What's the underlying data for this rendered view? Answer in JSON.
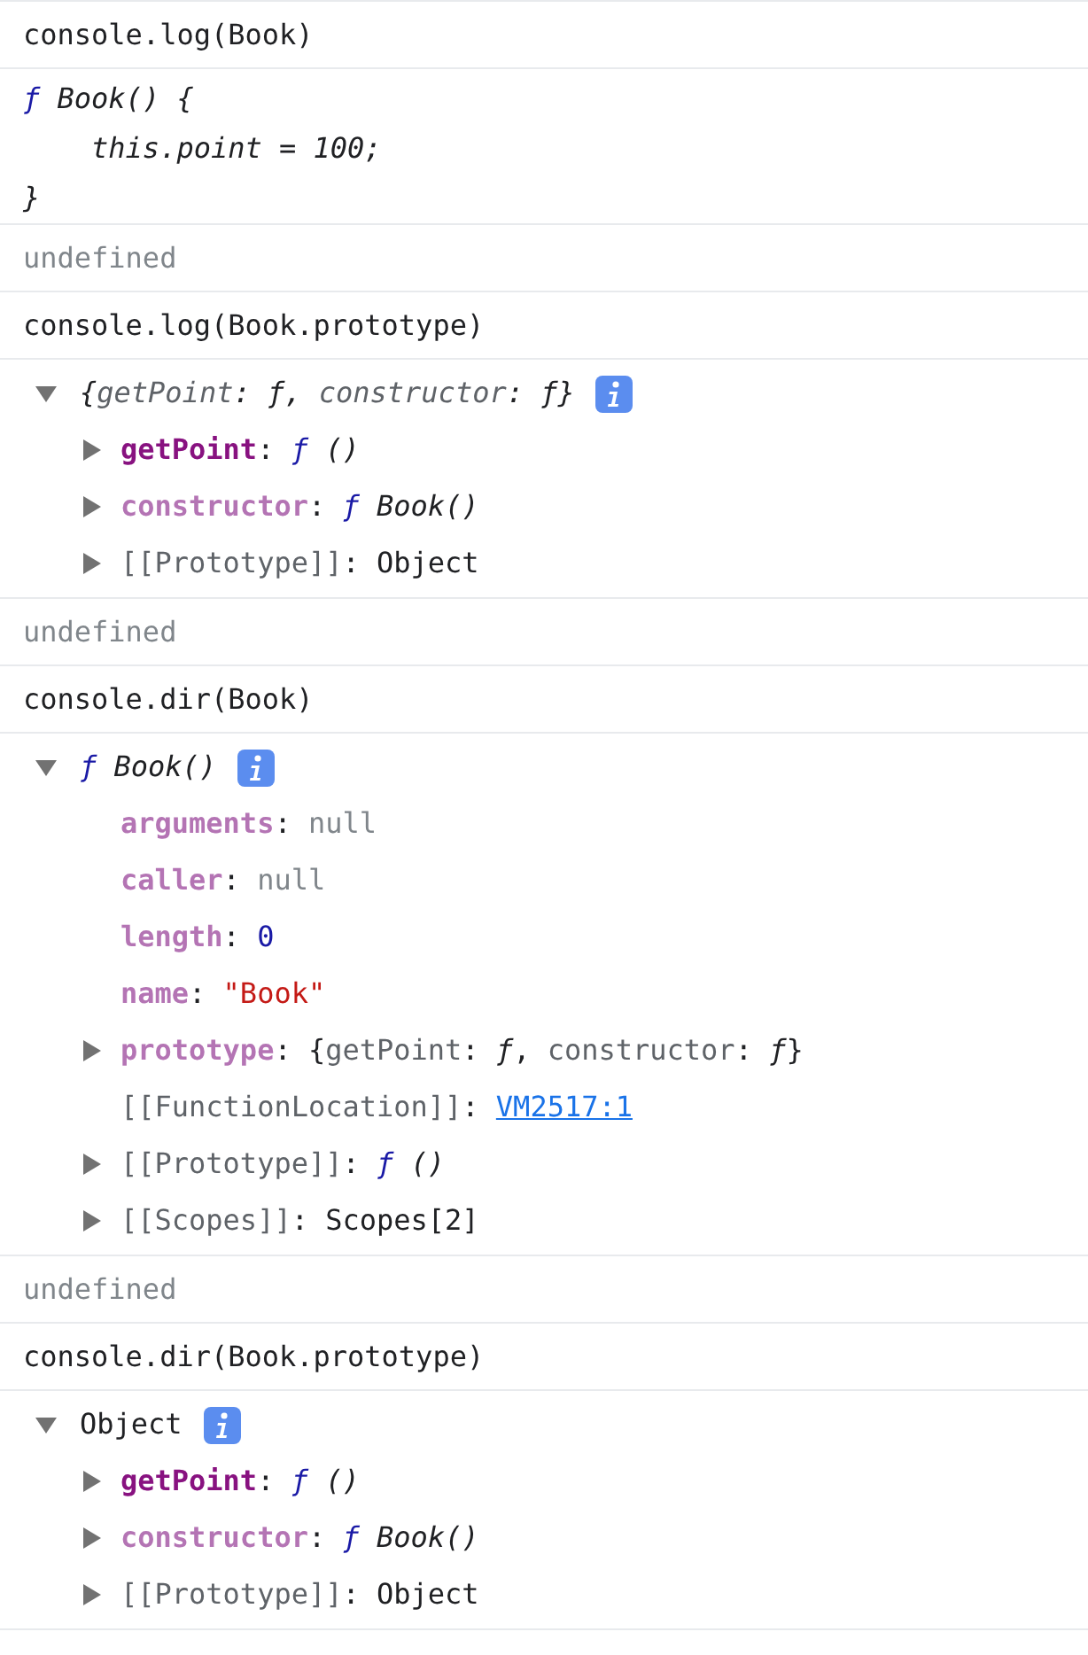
{
  "entries": [
    {
      "kind": "command",
      "text": "console.log(Book)"
    },
    {
      "kind": "source",
      "lines": [
        [
          {
            "kind": "fn",
            "text": "ƒ"
          },
          {
            "kind": "italic",
            "text": " Book() {"
          }
        ],
        [
          {
            "kind": "italic",
            "text": "    this.point = 100;"
          }
        ],
        [
          {
            "kind": "italic",
            "text": "}"
          }
        ]
      ]
    },
    {
      "kind": "result",
      "text": "undefined"
    },
    {
      "kind": "command",
      "text": "console.log(Book.prototype)"
    },
    {
      "kind": "tree",
      "expanded": true,
      "info": true,
      "parts": [
        {
          "kind": "italic",
          "text": "{"
        },
        {
          "kind": "preview_key_italic",
          "text": "getPoint"
        },
        {
          "kind": "italic",
          "text": ": ƒ, "
        },
        {
          "kind": "preview_key_italic",
          "text": "constructor"
        },
        {
          "kind": "italic",
          "text": ": ƒ}"
        }
      ],
      "children": [
        {
          "expanded": false,
          "parts": [
            {
              "kind": "key",
              "text": "getPoint"
            },
            {
              "kind": "plain",
              "text": ": "
            },
            {
              "kind": "fn",
              "text": "ƒ"
            },
            {
              "kind": "italic",
              "text": " ()"
            }
          ]
        },
        {
          "expanded": false,
          "parts": [
            {
              "kind": "key_dim",
              "text": "constructor"
            },
            {
              "kind": "plain",
              "text": ": "
            },
            {
              "kind": "fn",
              "text": "ƒ"
            },
            {
              "kind": "italic",
              "text": " Book()"
            }
          ]
        },
        {
          "expanded": false,
          "parts": [
            {
              "kind": "internal",
              "text": "[[Prototype]]"
            },
            {
              "kind": "plain",
              "text": ": Object"
            }
          ]
        }
      ]
    },
    {
      "kind": "result",
      "text": "undefined"
    },
    {
      "kind": "command",
      "text": "console.dir(Book)"
    },
    {
      "kind": "tree",
      "expanded": true,
      "info": true,
      "parts": [
        {
          "kind": "fn",
          "text": "ƒ"
        },
        {
          "kind": "italic",
          "text": " Book()"
        }
      ],
      "children": [
        {
          "parts": [
            {
              "kind": "key_dim",
              "text": "arguments"
            },
            {
              "kind": "plain",
              "text": ": "
            },
            {
              "kind": "null",
              "text": "null"
            }
          ]
        },
        {
          "parts": [
            {
              "kind": "key_dim",
              "text": "caller"
            },
            {
              "kind": "plain",
              "text": ": "
            },
            {
              "kind": "null",
              "text": "null"
            }
          ]
        },
        {
          "parts": [
            {
              "kind": "key_dim",
              "text": "length"
            },
            {
              "kind": "plain",
              "text": ": "
            },
            {
              "kind": "number",
              "text": "0"
            }
          ]
        },
        {
          "parts": [
            {
              "kind": "key_dim",
              "text": "name"
            },
            {
              "kind": "plain",
              "text": ": "
            },
            {
              "kind": "string",
              "text": "\"Book\""
            }
          ]
        },
        {
          "expanded": false,
          "parts": [
            {
              "kind": "key_dim",
              "text": "prototype"
            },
            {
              "kind": "plain",
              "text": ": {"
            },
            {
              "kind": "preview_key",
              "text": "getPoint"
            },
            {
              "kind": "plain",
              "text": ": "
            },
            {
              "kind": "italic",
              "text": "ƒ"
            },
            {
              "kind": "plain",
              "text": ", "
            },
            {
              "kind": "preview_key",
              "text": "constructor"
            },
            {
              "kind": "plain",
              "text": ": "
            },
            {
              "kind": "italic",
              "text": "ƒ"
            },
            {
              "kind": "plain",
              "text": "}"
            }
          ]
        },
        {
          "parts": [
            {
              "kind": "internal",
              "text": "[[FunctionLocation]]"
            },
            {
              "kind": "plain",
              "text": ": "
            },
            {
              "kind": "link",
              "text": "VM2517:1"
            }
          ]
        },
        {
          "expanded": false,
          "parts": [
            {
              "kind": "internal",
              "text": "[[Prototype]]"
            },
            {
              "kind": "plain",
              "text": ": "
            },
            {
              "kind": "fn",
              "text": "ƒ"
            },
            {
              "kind": "italic",
              "text": " ()"
            }
          ]
        },
        {
          "expanded": false,
          "parts": [
            {
              "kind": "internal",
              "text": "[[Scopes]]"
            },
            {
              "kind": "plain",
              "text": ": Scopes[2]"
            }
          ]
        }
      ]
    },
    {
      "kind": "result",
      "text": "undefined"
    },
    {
      "kind": "command",
      "text": "console.dir(Book.prototype)"
    },
    {
      "kind": "tree",
      "expanded": true,
      "info": true,
      "parts": [
        {
          "kind": "plain",
          "text": "Object"
        }
      ],
      "children": [
        {
          "expanded": false,
          "parts": [
            {
              "kind": "key",
              "text": "getPoint"
            },
            {
              "kind": "plain",
              "text": ": "
            },
            {
              "kind": "fn",
              "text": "ƒ"
            },
            {
              "kind": "italic",
              "text": " ()"
            }
          ]
        },
        {
          "expanded": false,
          "parts": [
            {
              "kind": "key_dim",
              "text": "constructor"
            },
            {
              "kind": "plain",
              "text": ": "
            },
            {
              "kind": "fn",
              "text": "ƒ"
            },
            {
              "kind": "italic",
              "text": " Book()"
            }
          ]
        },
        {
          "expanded": false,
          "parts": [
            {
              "kind": "internal",
              "text": "[[Prototype]]"
            },
            {
              "kind": "plain",
              "text": ": Object"
            }
          ]
        }
      ]
    }
  ]
}
